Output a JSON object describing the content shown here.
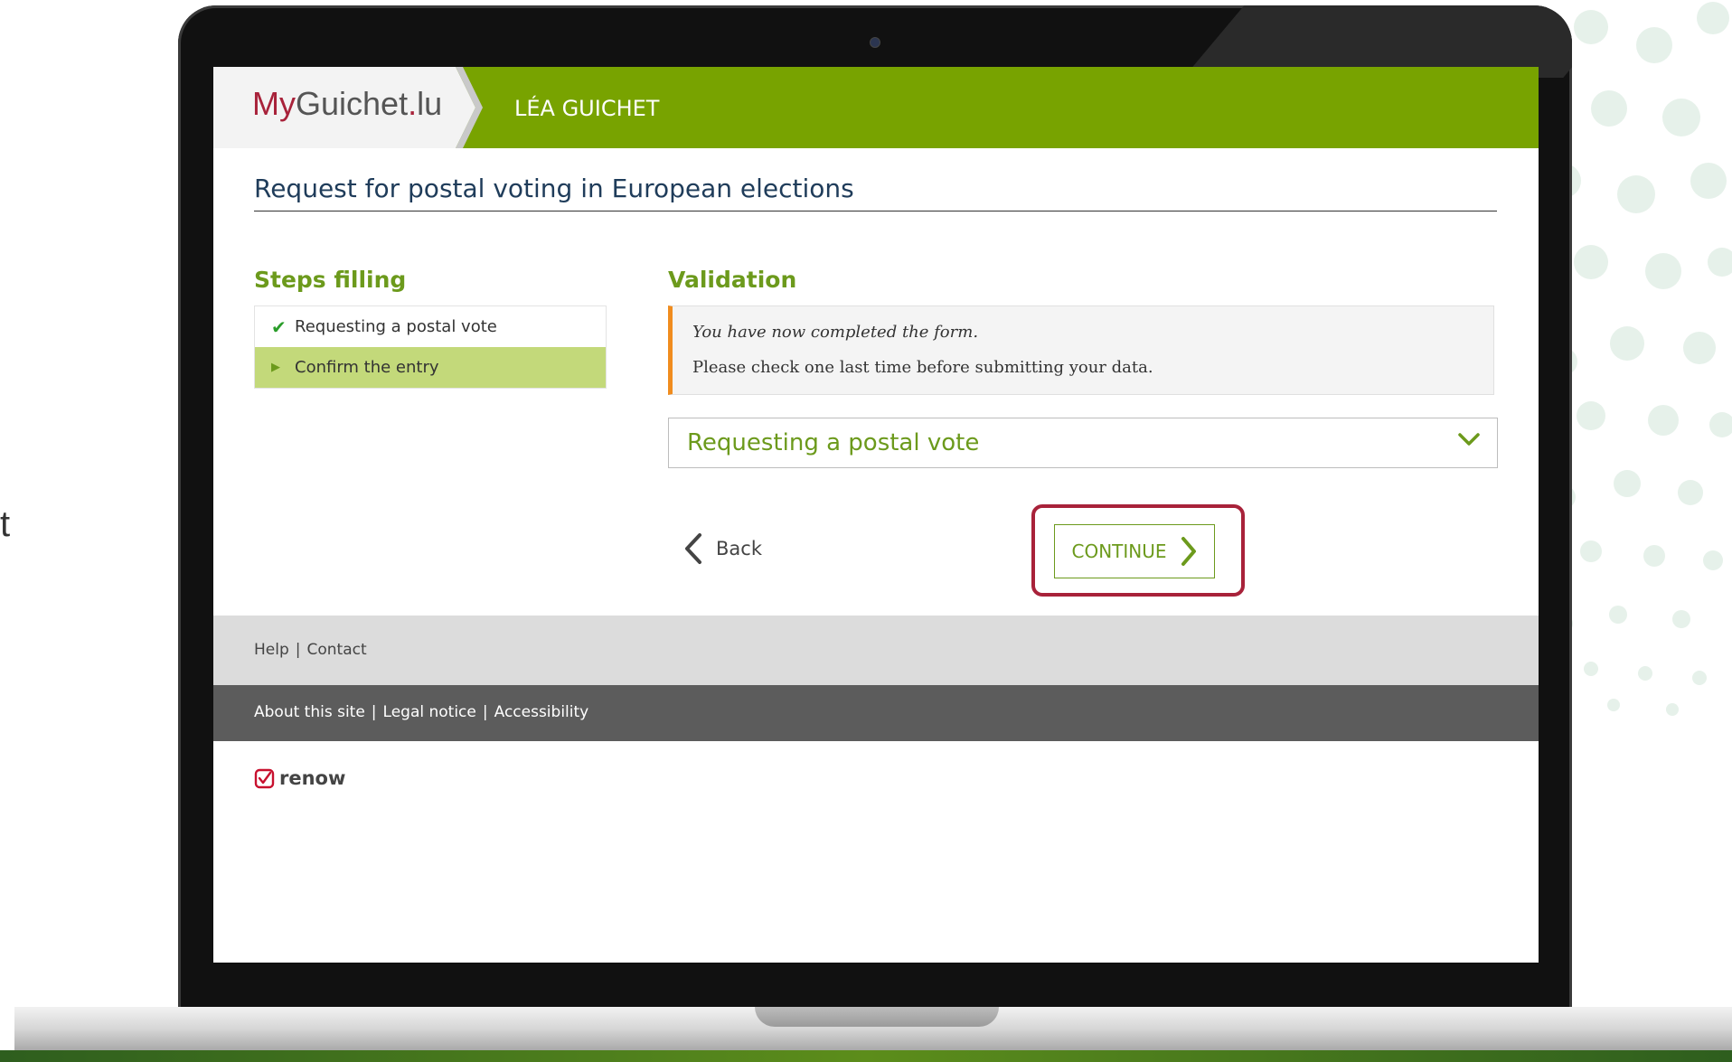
{
  "header": {
    "logo_my": "My",
    "logo_guichet": "Guichet",
    "logo_dot": ".",
    "logo_lu": "lu",
    "user_name": "LÉA GUICHET"
  },
  "page": {
    "title": "Request for postal voting in European elections"
  },
  "steps": {
    "heading": "Steps filling",
    "items": [
      {
        "label": "Requesting a postal vote",
        "state": "completed"
      },
      {
        "label": "Confirm the entry",
        "state": "current"
      }
    ]
  },
  "validation": {
    "heading": "Validation",
    "message_italic": "You have now completed the form.",
    "message": "Please check one last time before submitting your data.",
    "accordion_label": "Requesting a postal vote"
  },
  "actions": {
    "back_label": "Back",
    "continue_label": "CONTINUE"
  },
  "footer": {
    "row1": [
      "Help",
      "Contact"
    ],
    "row2": [
      "About this site",
      "Legal notice",
      "Accessibility"
    ],
    "separator": "|",
    "brand": "renow"
  },
  "background": {
    "stray_letter": "t"
  },
  "colors": {
    "header_green": "#78a300",
    "accent_green": "#6c9a1c",
    "active_step": "#c3d97a",
    "highlight_red": "#a8223a",
    "warning_orange": "#f08c1e"
  }
}
